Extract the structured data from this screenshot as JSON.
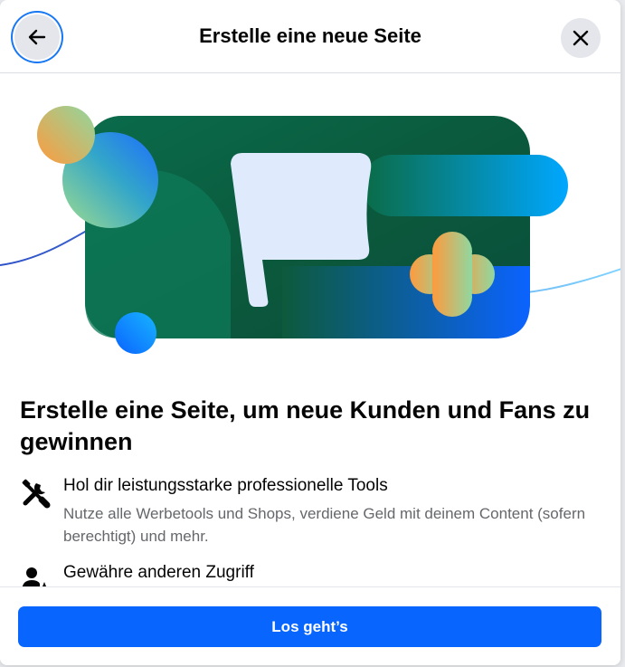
{
  "header": {
    "title": "Erstelle eine neue Seite",
    "back_icon": "arrow-left-icon",
    "close_icon": "close-icon"
  },
  "hero": {
    "illustration": "flag-illustration"
  },
  "main": {
    "headline": "Erstelle eine Seite, um neue Kunden und Fans zu gewinnen",
    "features": [
      {
        "icon": "tools-icon",
        "title": "Hol dir leistungsstarke professionelle Tools",
        "description": "Nutze alle Werbetools und Shops, verdiene Geld mit deinem Content (sofern berechtigt) und mehr."
      },
      {
        "icon": "user-star-icon",
        "title": "Gewähre anderen Zugriff",
        "description": ""
      }
    ]
  },
  "footer": {
    "cta_label": "Los geht’s"
  },
  "colors": {
    "primary": "#0866ff",
    "focus_ring": "#1877f2",
    "text_primary": "#050505",
    "text_secondary": "#65676b",
    "button_gray": "#e4e6eb"
  }
}
